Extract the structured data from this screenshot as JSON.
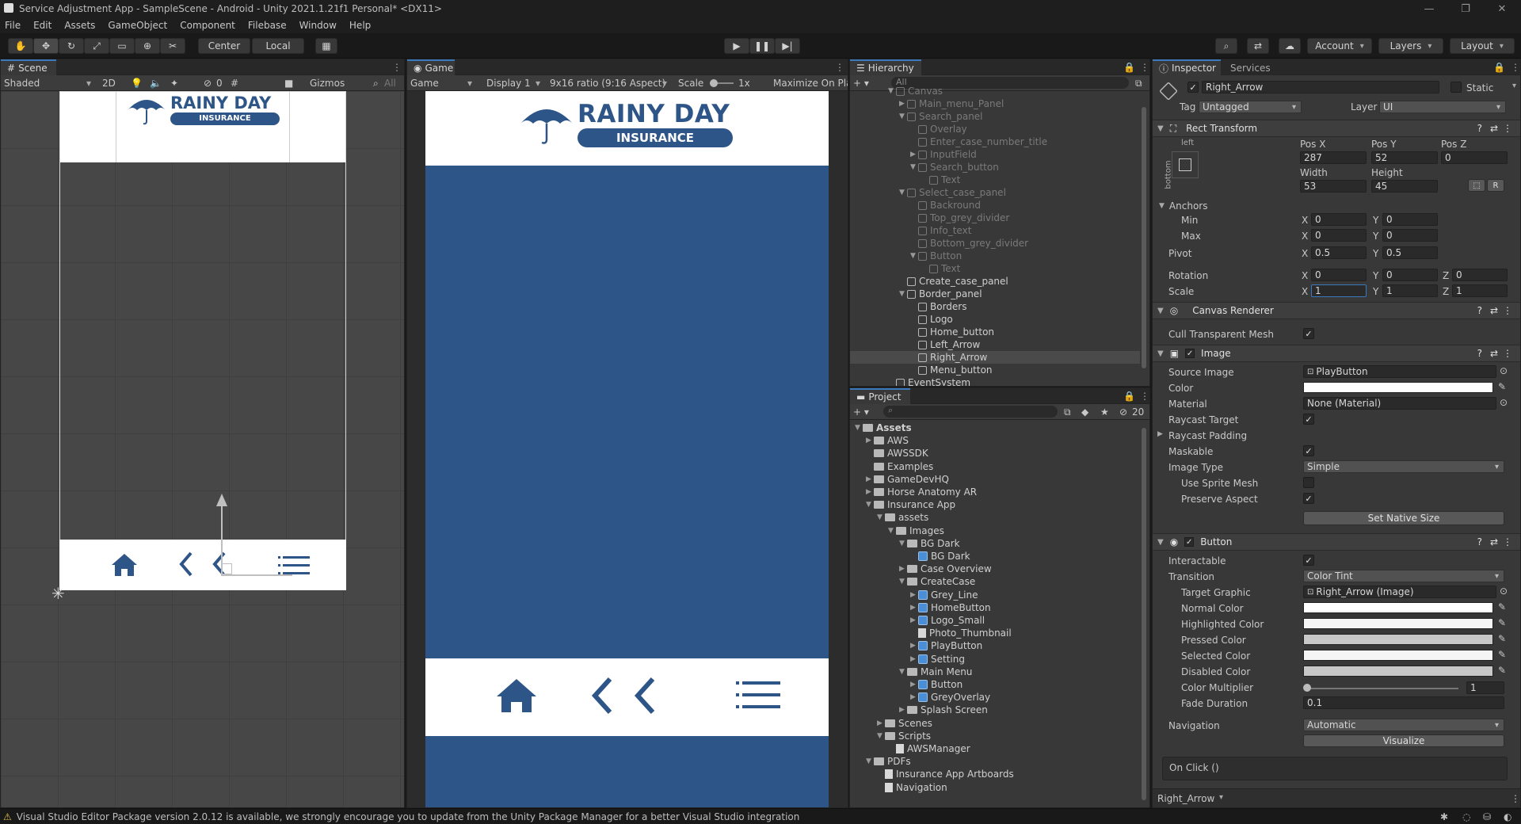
{
  "window": {
    "title": "Service Adjustment App - SampleScene - Android - Unity 2021.1.21f1 Personal* <DX11>"
  },
  "menu": [
    "File",
    "Edit",
    "Assets",
    "GameObject",
    "Component",
    "Filebase",
    "Window",
    "Help"
  ],
  "toolbar": {
    "pivot_mode": "Center",
    "pivot_space": "Local",
    "account": "Account",
    "layers": "Layers",
    "layout": "Layout"
  },
  "scene": {
    "tab": "Scene",
    "shading": "Shaded",
    "mode_2d": "2D",
    "hidden_count": "0",
    "gizmos": "Gizmos",
    "search_placeholder": "All"
  },
  "game": {
    "tab": "Game",
    "view_mode": "Game",
    "display": "Display 1",
    "aspect": "9x16 ratio (9:16 Aspect)",
    "scale_label": "Scale",
    "scale_value": "1x",
    "maximize": "Maximize On Pla",
    "logo_title": "RAINY DAY",
    "logo_subtitle": "INSURANCE",
    "colors": {
      "header_bg": "#ffffff",
      "body_bg": "#2d5587",
      "brand": "#2d5587"
    }
  },
  "hierarchy": {
    "tab": "Hierarchy",
    "search_placeholder": "All",
    "items": [
      {
        "label": "Canvas",
        "indent": 4,
        "dim": true,
        "arrow": "▼"
      },
      {
        "label": "Main_menu_Panel",
        "indent": 5,
        "dim": true,
        "arrow": "▶"
      },
      {
        "label": "Search_panel",
        "indent": 5,
        "dim": true,
        "arrow": "▼"
      },
      {
        "label": "Overlay",
        "indent": 6,
        "dim": true,
        "arrow": ""
      },
      {
        "label": "Enter_case_number_title",
        "indent": 6,
        "dim": true,
        "arrow": ""
      },
      {
        "label": "InputField",
        "indent": 6,
        "dim": true,
        "arrow": "▶"
      },
      {
        "label": "Search_button",
        "indent": 6,
        "dim": true,
        "arrow": "▼"
      },
      {
        "label": "Text",
        "indent": 7,
        "dim": true,
        "arrow": ""
      },
      {
        "label": "Select_case_panel",
        "indent": 5,
        "dim": true,
        "arrow": "▼"
      },
      {
        "label": "Backround",
        "indent": 6,
        "dim": true,
        "arrow": ""
      },
      {
        "label": "Top_grey_divider",
        "indent": 6,
        "dim": true,
        "arrow": ""
      },
      {
        "label": "Info_text",
        "indent": 6,
        "dim": true,
        "arrow": ""
      },
      {
        "label": "Bottom_grey_divider",
        "indent": 6,
        "dim": true,
        "arrow": ""
      },
      {
        "label": "Button",
        "indent": 6,
        "dim": true,
        "arrow": "▼"
      },
      {
        "label": "Text",
        "indent": 7,
        "dim": true,
        "arrow": ""
      },
      {
        "label": "Create_case_panel",
        "indent": 5,
        "dim": false,
        "arrow": ""
      },
      {
        "label": "Border_panel",
        "indent": 5,
        "dim": false,
        "arrow": "▼"
      },
      {
        "label": "Borders",
        "indent": 6,
        "dim": false,
        "arrow": ""
      },
      {
        "label": "Logo",
        "indent": 6,
        "dim": false,
        "arrow": ""
      },
      {
        "label": "Home_button",
        "indent": 6,
        "dim": false,
        "arrow": ""
      },
      {
        "label": "Left_Arrow",
        "indent": 6,
        "dim": false,
        "arrow": ""
      },
      {
        "label": "Right_Arrow",
        "indent": 6,
        "dim": false,
        "arrow": "",
        "selected": true
      },
      {
        "label": "Menu_button",
        "indent": 6,
        "dim": false,
        "arrow": ""
      },
      {
        "label": "EventSystem",
        "indent": 4,
        "dim": false,
        "arrow": ""
      }
    ]
  },
  "project": {
    "tab": "Project",
    "hidden_count": "20",
    "items": [
      {
        "label": "Assets",
        "indent": 0,
        "icon": "folder",
        "arrow": "▼",
        "bold": true
      },
      {
        "label": "AWS",
        "indent": 1,
        "icon": "folder",
        "arrow": "▶"
      },
      {
        "label": "AWSSDK",
        "indent": 1,
        "icon": "folder",
        "arrow": ""
      },
      {
        "label": "Examples",
        "indent": 1,
        "icon": "folder",
        "arrow": ""
      },
      {
        "label": "GameDevHQ",
        "indent": 1,
        "icon": "folder",
        "arrow": "▶"
      },
      {
        "label": "Horse Anatomy AR",
        "indent": 1,
        "icon": "folder",
        "arrow": "▶"
      },
      {
        "label": "Insurance App",
        "indent": 1,
        "icon": "folder",
        "arrow": "▼"
      },
      {
        "label": "assets",
        "indent": 2,
        "icon": "folder",
        "arrow": "▼"
      },
      {
        "label": "Images",
        "indent": 3,
        "icon": "folder",
        "arrow": "▼"
      },
      {
        "label": "BG Dark",
        "indent": 4,
        "icon": "folder",
        "arrow": "▼"
      },
      {
        "label": "BG Dark",
        "indent": 5,
        "icon": "sprite",
        "arrow": ""
      },
      {
        "label": "Case Overview",
        "indent": 4,
        "icon": "folder",
        "arrow": "▶"
      },
      {
        "label": "CreateCase",
        "indent": 4,
        "icon": "folder",
        "arrow": "▼"
      },
      {
        "label": "Grey_Line",
        "indent": 5,
        "icon": "sprite",
        "arrow": "▶"
      },
      {
        "label": "HomeButton",
        "indent": 5,
        "icon": "sprite",
        "arrow": "▶"
      },
      {
        "label": "Logo_Small",
        "indent": 5,
        "icon": "sprite",
        "arrow": "▶"
      },
      {
        "label": "Photo_Thumbnail",
        "indent": 5,
        "icon": "doc",
        "arrow": ""
      },
      {
        "label": "PlayButton",
        "indent": 5,
        "icon": "sprite",
        "arrow": "▶"
      },
      {
        "label": "Setting",
        "indent": 5,
        "icon": "sprite",
        "arrow": "▶"
      },
      {
        "label": "Main Menu",
        "indent": 4,
        "icon": "folder",
        "arrow": "▼"
      },
      {
        "label": "Button",
        "indent": 5,
        "icon": "sprite",
        "arrow": "▶"
      },
      {
        "label": "GreyOverlay",
        "indent": 5,
        "icon": "sprite",
        "arrow": "▶"
      },
      {
        "label": "Splash Screen",
        "indent": 4,
        "icon": "folder",
        "arrow": "▶"
      },
      {
        "label": "Scenes",
        "indent": 2,
        "icon": "folder",
        "arrow": "▶"
      },
      {
        "label": "Scripts",
        "indent": 2,
        "icon": "folder",
        "arrow": "▼"
      },
      {
        "label": "AWSManager",
        "indent": 3,
        "icon": "doc",
        "arrow": ""
      },
      {
        "label": "PDFs",
        "indent": 1,
        "icon": "folder",
        "arrow": "▼"
      },
      {
        "label": "Insurance App Artboards",
        "indent": 2,
        "icon": "doc",
        "arrow": ""
      },
      {
        "label": "Navigation",
        "indent": 2,
        "icon": "doc",
        "arrow": ""
      }
    ]
  },
  "inspector": {
    "tab": "Inspector",
    "tab2": "Services",
    "object_name": "Right_Arrow",
    "static_label": "Static",
    "tag_label": "Tag",
    "tag_value": "Untagged",
    "layer_label": "Layer",
    "layer_value": "UI",
    "rect": {
      "title": "Rect Transform",
      "anchor_h": "left",
      "anchor_v": "bottom",
      "posx_label": "Pos X",
      "posx": "287",
      "posy_label": "Pos Y",
      "posy": "52",
      "posz_label": "Pos Z",
      "posz": "0",
      "width_label": "Width",
      "width": "53",
      "height_label": "Height",
      "height": "45",
      "anchors": "Anchors",
      "min": "Min",
      "min_x": "0",
      "min_y": "0",
      "max": "Max",
      "max_x": "0",
      "max_y": "0",
      "pivot": "Pivot",
      "pivot_x": "0.5",
      "pivot_y": "0.5",
      "rotation": "Rotation",
      "rot_x": "0",
      "rot_y": "0",
      "rot_z": "0",
      "scale": "Scale",
      "scale_x": "1",
      "scale_y": "1",
      "scale_z": "1",
      "r_button": "R"
    },
    "canvas_renderer": {
      "title": "Canvas Renderer",
      "cull_label": "Cull Transparent Mesh"
    },
    "image": {
      "title": "Image",
      "source_label": "Source Image",
      "source": "PlayButton",
      "color_label": "Color",
      "material_label": "Material",
      "material": "None (Material)",
      "raycast_label": "Raycast Target",
      "padding_label": "Raycast Padding",
      "maskable_label": "Maskable",
      "type_label": "Image Type",
      "type": "Simple",
      "sprite_mesh_label": "Use Sprite Mesh",
      "preserve_label": "Preserve Aspect",
      "native_button": "Set Native Size"
    },
    "button": {
      "title": "Button",
      "interactable_label": "Interactable",
      "transition_label": "Transition",
      "transition": "Color Tint",
      "target_label": "Target Graphic",
      "target": "Right_Arrow (Image)",
      "normal_label": "Normal Color",
      "highlighted_label": "Highlighted Color",
      "pressed_label": "Pressed Color",
      "selected_label": "Selected Color",
      "disabled_label": "Disabled Color",
      "multiplier_label": "Color Multiplier",
      "multiplier": "1",
      "fade_label": "Fade Duration",
      "fade": "0.1",
      "navigation_label": "Navigation",
      "navigation": "Automatic",
      "visualize": "Visualize",
      "onclick": "On Click ()"
    },
    "footer": "Right_Arrow"
  },
  "status": {
    "message": "Visual Studio Editor Package version 2.0.12 is available, we strongly encourage you to update from the Unity Package Manager for a better Visual Studio integration"
  }
}
